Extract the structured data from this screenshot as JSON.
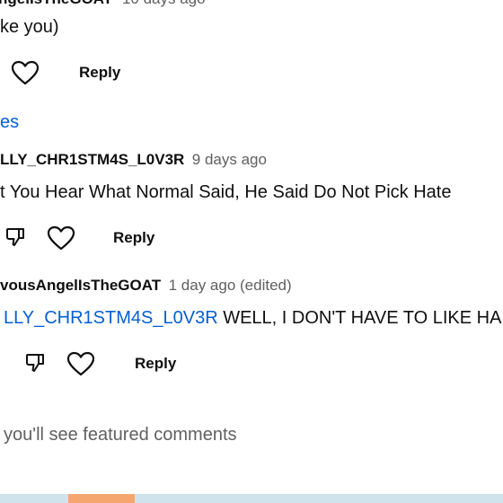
{
  "comment_top": {
    "author_partial": "ngelIsTheGOAT",
    "time_partial": "10 days ago",
    "text_partial": "ke you)",
    "reply_label": "Reply"
  },
  "replies_toggle": {
    "label_partial": "es"
  },
  "reply_1": {
    "author": "LLY_CHR1STM4S_L0V3R",
    "time": "9 days ago",
    "text": "t You Hear What Normal Said, He Said Do Not Pick Hate",
    "reply_label": "Reply"
  },
  "reply_2": {
    "author": "vousAngelIsTheGOAT",
    "time": "1 day ago (edited)",
    "mention": "LLY_CHR1STM4S_L0V3R",
    "text": "WELL, I DON'T HAVE TO LIKE HA",
    "reply_label": "Reply"
  },
  "footer": {
    "featured_text": "you'll see featured comments"
  },
  "colors": {
    "link": "#065fd4",
    "text": "#0f0f0f",
    "meta": "#606060",
    "bar": "#cfe3ec",
    "accent": "#f5a66f"
  },
  "icons": [
    "heart-icon",
    "dislike-icon"
  ]
}
